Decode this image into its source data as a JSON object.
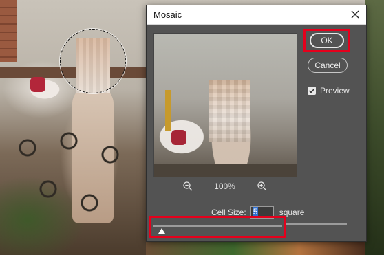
{
  "dialog": {
    "title": "Mosaic",
    "close_icon": "close-icon",
    "ok_label": "OK",
    "cancel_label": "Cancel",
    "preview_label": "Preview",
    "preview_checked": true,
    "zoom": "100%",
    "zoom_out_icon": "zoom-out-icon",
    "zoom_in_icon": "zoom-in-icon",
    "cell_size_label": "Cell Size:",
    "cell_size_value": "5",
    "cell_size_unit": "square",
    "slider_value": 5
  },
  "colors": {
    "highlight": "#e5001c",
    "dialog_bg": "#535353",
    "selection_blue": "#2f6fd1"
  }
}
